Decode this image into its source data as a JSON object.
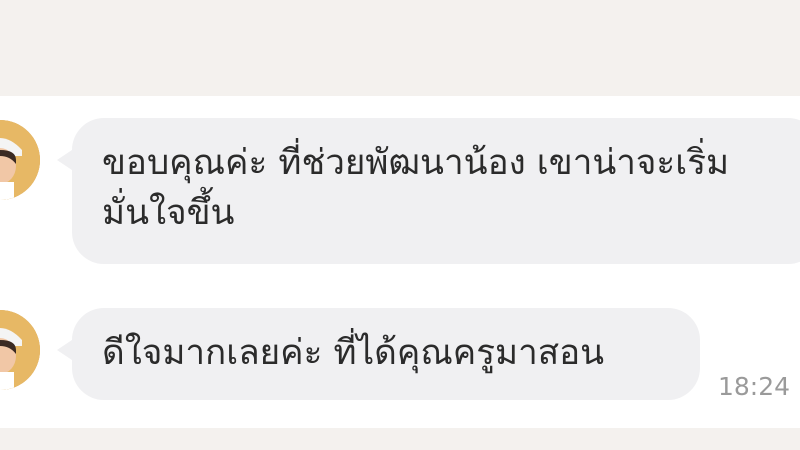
{
  "messages": [
    {
      "text": "ขอบคุณค่ะ ที่ช่วยพัฒนาน้อง เขาน่าจะเริ่มมั่นใจขึ้น",
      "time": ""
    },
    {
      "text": "ดีใจมากเลยค่ะ ที่ได้คุณครูมาสอน",
      "time": "18:24"
    }
  ],
  "colors": {
    "bubble": "#f0f0f2",
    "background": "#ffffff",
    "band": "#f4f1ee",
    "text": "#2b2b2b",
    "timestamp": "#9a9a9a"
  },
  "icons": {
    "avatar": "teacher-avatar"
  }
}
